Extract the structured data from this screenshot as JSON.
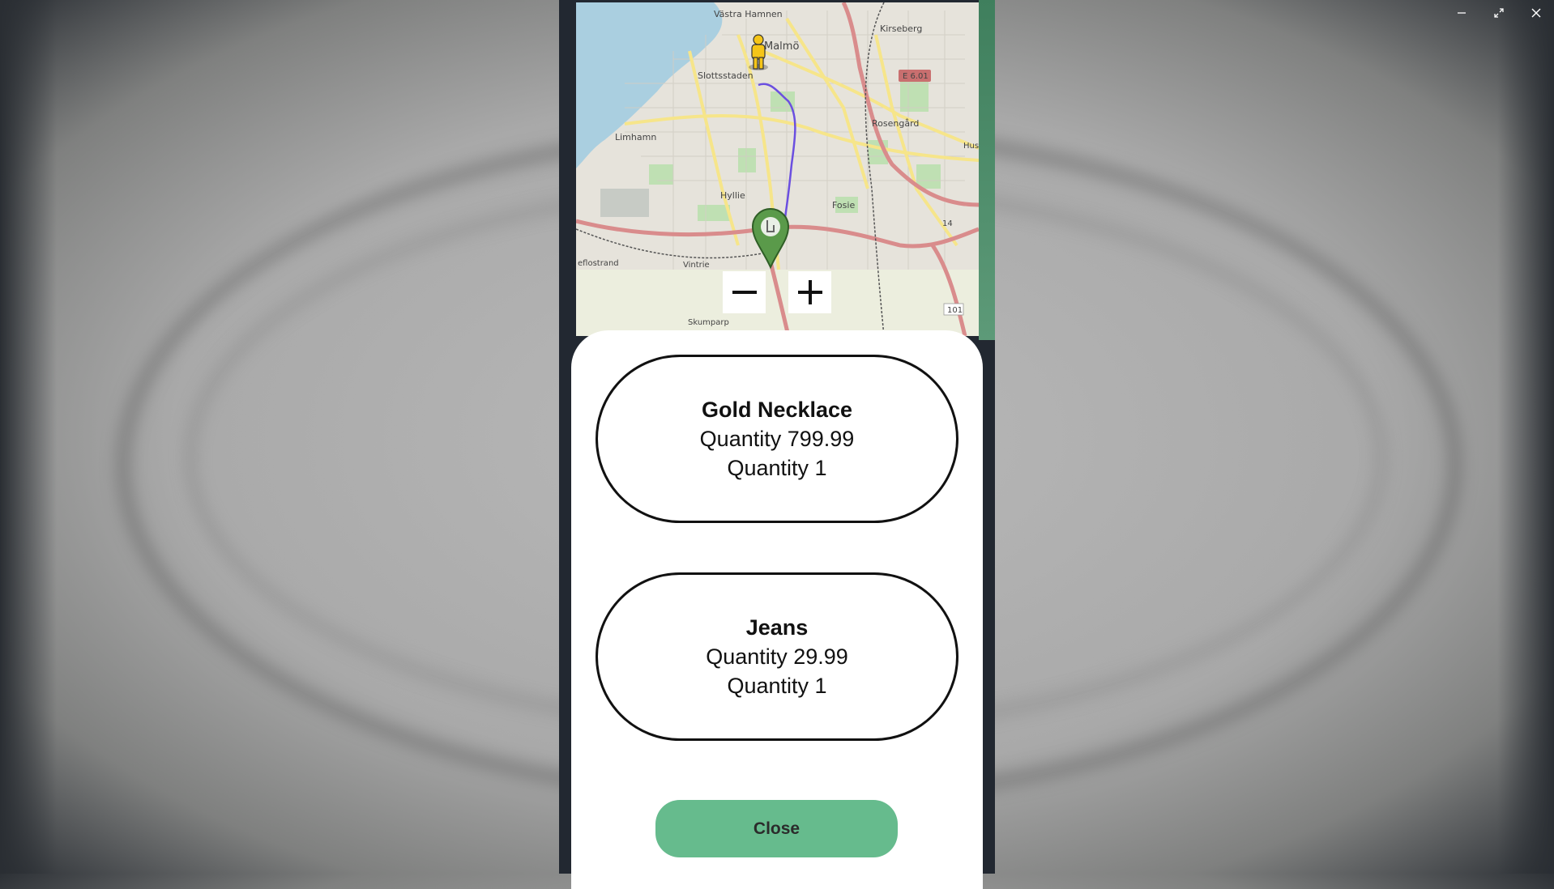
{
  "window": {
    "minimize_icon": "minimize-icon",
    "restore_icon": "restore-icon",
    "close_icon": "close-icon"
  },
  "map": {
    "places": {
      "vastra_hamnen": "Västra Hamnen",
      "malmo": "Malmö",
      "kirseberg": "Kirseberg",
      "slottsstaden": "Slottsstaden",
      "e601": "E 6.01",
      "limhamn": "Limhamn",
      "rosengard": "Rosengård",
      "husie": "Hus",
      "hyllie": "Hyllie",
      "fosie": "Fosie",
      "vintrie": "Vintrie",
      "eflostrand": "eflostrand",
      "skumparp": "Skumparp",
      "road101": "101",
      "road14": "14"
    },
    "colors": {
      "water": "#aacfe0",
      "land": "#e6e3db",
      "major_road": "#f6e58a",
      "motorway": "#d98c8c",
      "park": "#bfe0b3",
      "route": "#6b4fe0",
      "pin": "#5a9a4a"
    },
    "zoom_out_icon": "minus-icon",
    "zoom_in_icon": "plus-icon",
    "person_icon": "pegman-icon",
    "pin_icon": "map-pin-icon"
  },
  "orders": [
    {
      "name": "Gold Necklace",
      "price_line": "Quantity 799.99",
      "qty_line": "Quantity 1"
    },
    {
      "name": "Jeans",
      "price_line": "Quantity 29.99",
      "qty_line": "Quantity 1"
    }
  ],
  "close_button": {
    "label": "Close",
    "color": "#66bb8d"
  }
}
